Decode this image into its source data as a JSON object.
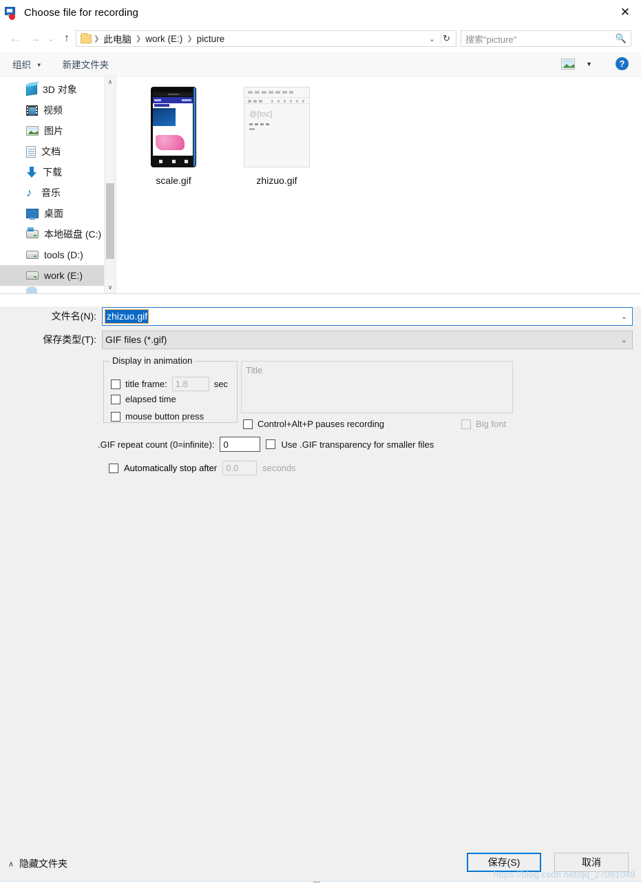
{
  "window": {
    "title": "Choose file for recording",
    "icon": "screen-record-icon",
    "close_label": "✕"
  },
  "nav": {
    "back_icon": "←",
    "forward_icon": "→",
    "history_icon": "⌄",
    "up_icon": "↑",
    "breadcrumb": [
      {
        "label": "此电脑"
      },
      {
        "label": "work (E:)"
      },
      {
        "label": "picture"
      }
    ],
    "separator": "❯",
    "dropdown_icon": "⌄",
    "refresh_icon": "↻",
    "search": {
      "placeholder": "搜索\"picture\"",
      "icon": "search-icon"
    }
  },
  "commandbar": {
    "organize_label": "组织",
    "organize_caret": "▼",
    "new_folder_label": "新建文件夹",
    "view_icon": "picture-view-icon",
    "view_caret": "▼",
    "help_label": "?"
  },
  "navpane": {
    "items": [
      {
        "label": "3D 对象",
        "icon": "cube-icon",
        "icon_class": "ic-3d",
        "selected": false
      },
      {
        "label": "视频",
        "icon": "video-icon",
        "icon_class": "ic-video",
        "selected": false
      },
      {
        "label": "图片",
        "icon": "pictures-icon",
        "icon_class": "ic-pic",
        "selected": false
      },
      {
        "label": "文档",
        "icon": "documents-icon",
        "icon_class": "ic-doc",
        "selected": false
      },
      {
        "label": "下载",
        "icon": "downloads-icon",
        "icon_class": "ic-dl",
        "selected": false
      },
      {
        "label": "音乐",
        "icon": "music-icon",
        "icon_class": "ic-music",
        "selected": false
      },
      {
        "label": "桌面",
        "icon": "desktop-icon",
        "icon_class": "ic-desk",
        "selected": false
      },
      {
        "label": "本地磁盘 (C:)",
        "icon": "system-drive-icon",
        "icon_class": "ic-drive sys",
        "selected": false
      },
      {
        "label": "tools (D:)",
        "icon": "drive-icon",
        "icon_class": "ic-drive",
        "selected": false
      },
      {
        "label": "work (E:)",
        "icon": "drive-icon",
        "icon_class": "ic-drive",
        "selected": true
      }
    ],
    "scroll_up_icon": "∧",
    "scroll_down_icon": "∨"
  },
  "files": [
    {
      "name": "scale.gif",
      "thumb": "phone-screenshot-thumbnail"
    },
    {
      "name": "zhizuo.gif",
      "thumb": "editor-screenshot-thumbnail"
    }
  ],
  "thumb_text": {
    "editor_toc": "@[toc]"
  },
  "form": {
    "filename_label": "文件名(N):",
    "filename_value": "zhizuo.gif",
    "filetype_label": "保存类型(T):",
    "filetype_value": "GIF files (*.gif)",
    "combo_caret": "⌄"
  },
  "options": {
    "group_legend": "Display in animation",
    "title_frame": {
      "label": "title frame:",
      "checked": false,
      "value": "1.8",
      "unit": "sec"
    },
    "elapsed_time": {
      "label": "elapsed time",
      "checked": false
    },
    "mouse_button_press": {
      "label": "mouse button press",
      "checked": false
    },
    "title_placeholder": "Title",
    "title_value": "",
    "pause_hotkey": {
      "label": "Control+Alt+P pauses recording",
      "checked": false
    },
    "big_font": {
      "label": "Big font",
      "checked": false,
      "disabled": true
    },
    "repeat_count": {
      "label": ".GIF repeat count (0=infinite):",
      "value": "0"
    },
    "transparency": {
      "label": "Use .GIF transparency for smaller files",
      "checked": false
    },
    "auto_stop": {
      "label": "Automatically stop after",
      "checked": false,
      "value": "0.0",
      "unit": "seconds"
    }
  },
  "footer": {
    "hide_folders_label": "隐藏文件夹",
    "hide_folders_caret": "∧",
    "save_label": "保存(S)",
    "cancel_label": "取消",
    "watermark": "https://blog.csdn.net/qq_27061049"
  },
  "colors": {
    "accent": "#0078d7",
    "selection": "#0a6ac8",
    "chrome": "#f0f0f0",
    "record_dot": "#e3262b"
  }
}
